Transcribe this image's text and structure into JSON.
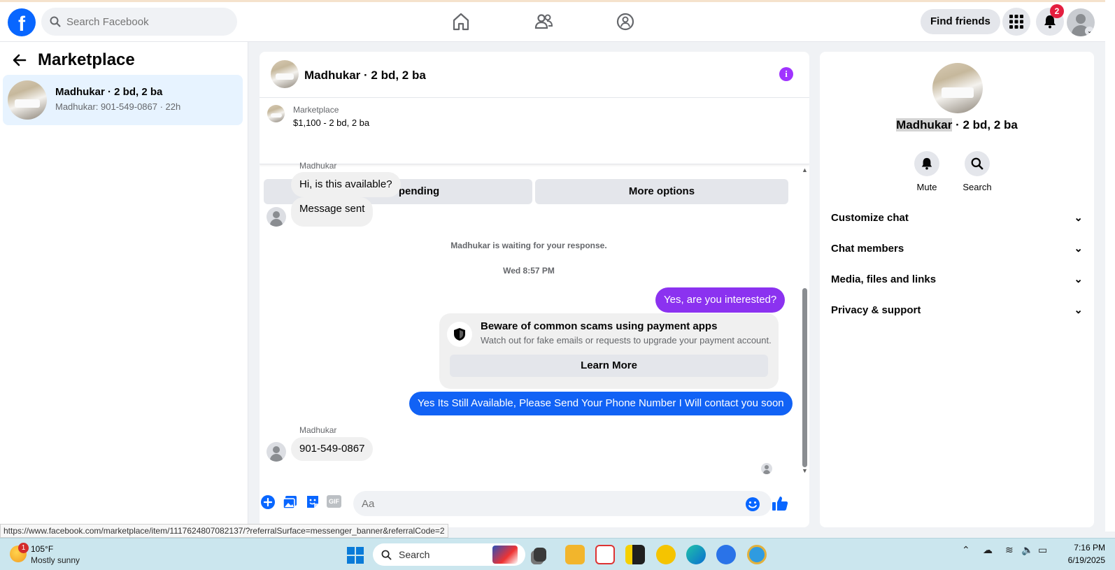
{
  "topbar": {
    "search_placeholder": "Search Facebook",
    "find_friends_label": "Find friends",
    "notification_count": "2"
  },
  "sidebar": {
    "title": "Marketplace",
    "conversation": {
      "title": "Madhukar · 2 bd, 2 ba",
      "subtitle": "Madhukar: 901-549-0867 · 22h"
    }
  },
  "chat": {
    "title": "Madhukar · 2 bd, 2 ba",
    "listing": {
      "source": "Marketplace",
      "price": "$1,100 - 2 bd, 2 ba",
      "mark_pending_label": "Mark as pending",
      "more_options_label": "More options"
    },
    "messages": {
      "sender_top": "Madhukar",
      "msg1": "Hi, is this available?",
      "msg2": "Message sent",
      "waiting": "Madhukar is waiting for your response.",
      "timestamp": "Wed 8:57 PM",
      "out1": "Yes, are you interested?",
      "warning_title": "Beware of common scams using payment apps",
      "warning_sub": "Watch out for fake emails or requests to upgrade your payment account.",
      "learn_more": "Learn More",
      "out2": "Yes Its Still Available, Please Send Your Phone Number I Will contact you soon",
      "sender_bottom": "Madhukar",
      "msg3": "901-549-0867"
    },
    "composer": {
      "placeholder": "Aa",
      "gif_label": "GIF"
    }
  },
  "details": {
    "name_highlighted": "Madhukar",
    "name_rest": " · 2 bd, 2 ba",
    "mute_label": "Mute",
    "search_label": "Search",
    "sections": [
      "Customize chat",
      "Chat members",
      "Media, files and links",
      "Privacy & support"
    ]
  },
  "status_url": "https://www.facebook.com/marketplace/item/1117624807082137/?referralSurface=messenger_banner&referralCode=2",
  "taskbar": {
    "weather_badge": "1",
    "temperature": "105°F",
    "condition": "Mostly sunny",
    "search_label": "Search",
    "time": "7:16 PM",
    "date": "6/19/2025"
  },
  "colors": {
    "facebook_blue": "#0866ff",
    "outgoing_purple": "#8b32f0",
    "outgoing_blue": "#1162f5",
    "badge_red": "#e41e3f",
    "info_purple": "#a033ff"
  }
}
